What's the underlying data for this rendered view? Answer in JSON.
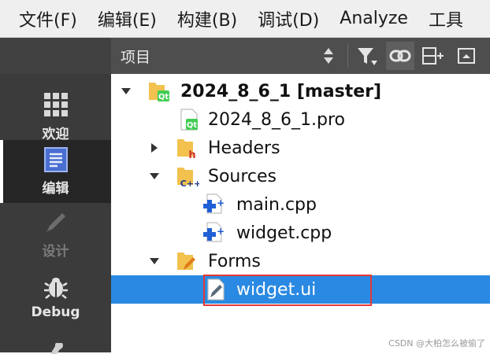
{
  "menu": [
    "文件(F)",
    "编辑(E)",
    "构建(B)",
    "调试(D)",
    "Analyze",
    "工具"
  ],
  "modes": [
    {
      "label": "欢迎",
      "icon": "grid-icon",
      "state": "normal"
    },
    {
      "label": "编辑",
      "icon": "document-edit-icon",
      "state": "active"
    },
    {
      "label": "设计",
      "icon": "pencil-icon",
      "state": "disabled"
    },
    {
      "label": "Debug",
      "icon": "bug-icon",
      "state": "normal"
    }
  ],
  "toolbar": {
    "title": "项目",
    "icons": [
      "sort-updown-icon",
      "filter-icon",
      "link-icon",
      "split-add-icon",
      "close-pane-icon"
    ]
  },
  "tree": {
    "project": "2024_8_6_1 [master]",
    "pro_file": "2024_8_6_1.pro",
    "headers": "Headers",
    "sources": "Sources",
    "main_cpp": "main.cpp",
    "widget_cpp": "widget.cpp",
    "forms": "Forms",
    "widget_ui": "widget.ui",
    "selected": "widget.ui"
  },
  "watermark": "CSDN @大柏怎么被偷了",
  "colors": {
    "selection": "#2a89e2",
    "highlight_box": "#e53935",
    "sidebar": "#3b3b3b",
    "toolbar": "#4e4e4e"
  }
}
